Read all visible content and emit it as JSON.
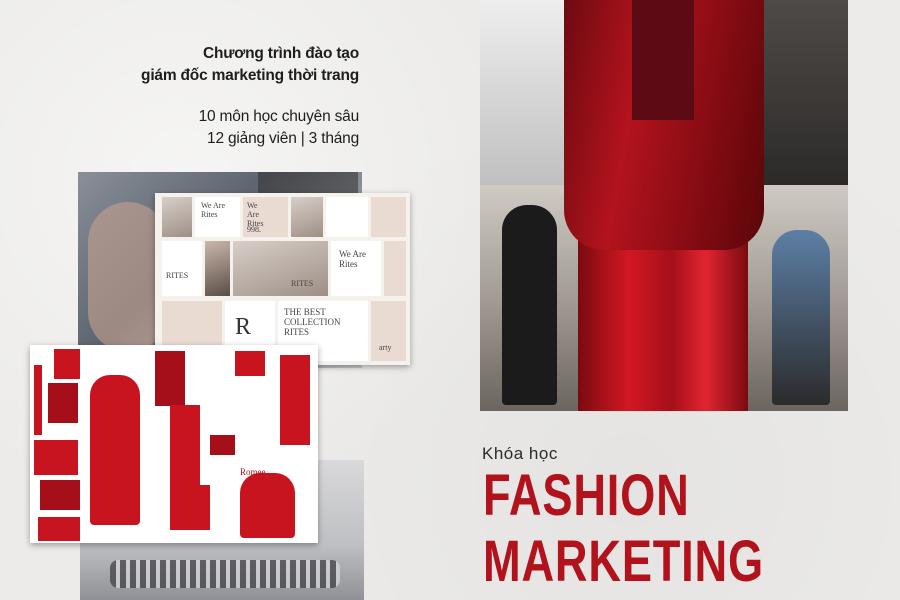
{
  "intro": {
    "line1": "Chương trình đào tạo",
    "line2": "giám đốc marketing thời trang",
    "line3": "10 môn học chuyên sâu",
    "line4": "12 giảng viên | 3 tháng"
  },
  "moodboard_text": {
    "t1": "We Are Rites",
    "t2": "We Are Rites",
    "t3": "998.",
    "t4": "RITES",
    "t5": "We Are Rites",
    "t6": "RITES",
    "t7": "R",
    "t8": "THE BEST COLLECTION RITES",
    "t9": "arty",
    "t10": "Romee"
  },
  "course": {
    "label": "Khóa học",
    "title_line1": "FASHION",
    "title_line2": "MARKETING"
  },
  "colors": {
    "accent": "#b1121c",
    "text": "#1e1e1e",
    "background": "#ecebe9"
  }
}
